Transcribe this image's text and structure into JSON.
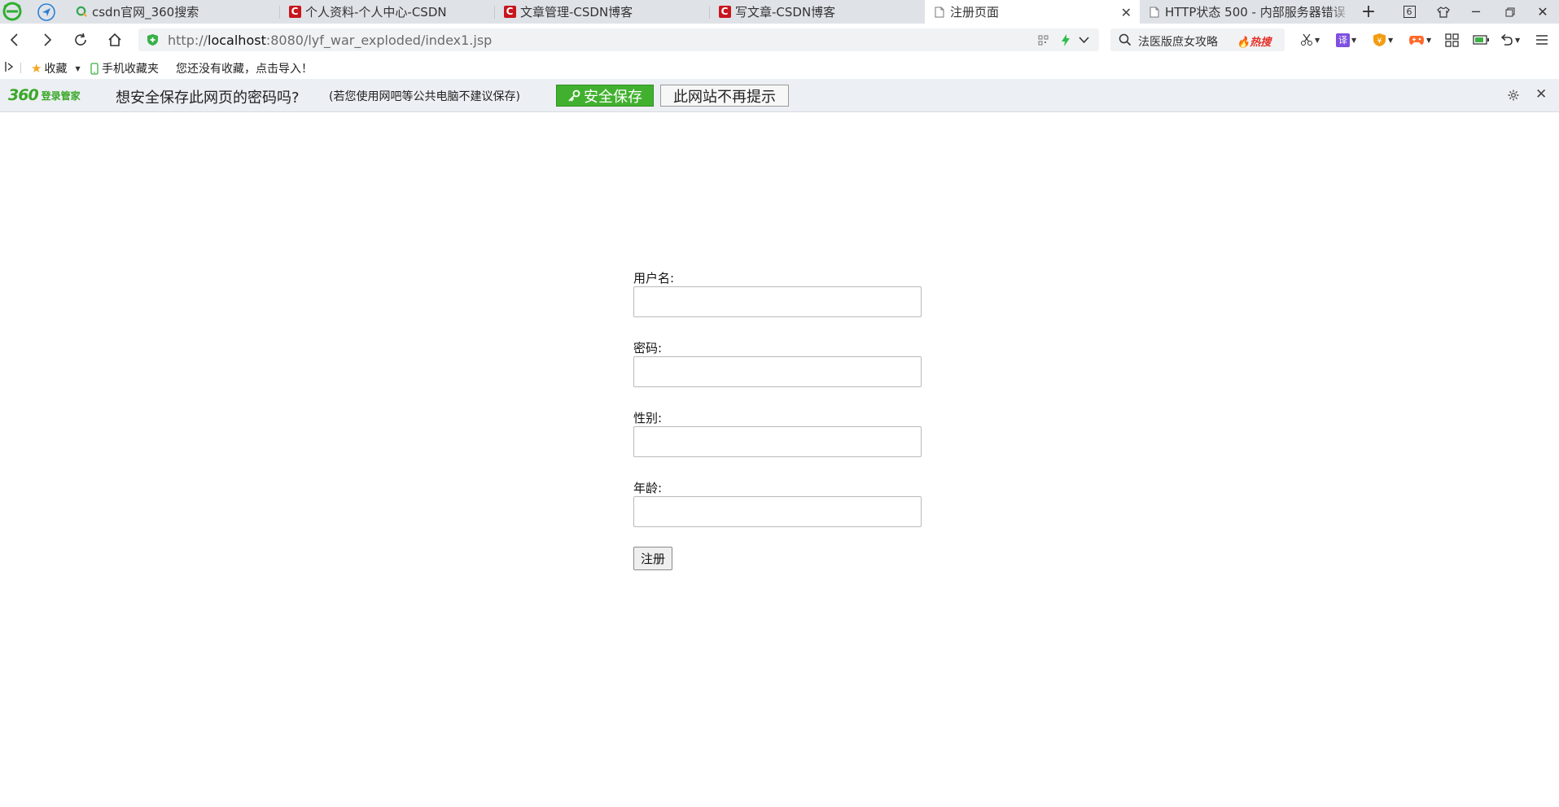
{
  "tabs": [
    {
      "title": "csdn官网_360搜索",
      "icon": "search-360-icon"
    },
    {
      "title": "个人资料-个人中心-CSDN",
      "icon": "csdn-icon"
    },
    {
      "title": "文章管理-CSDN博客",
      "icon": "csdn-icon"
    },
    {
      "title": "写文章-CSDN博客",
      "icon": "csdn-icon"
    },
    {
      "title": "注册页面",
      "icon": "page-icon",
      "active": true
    },
    {
      "title": "HTTP状态 500 - 内部服务器错误",
      "icon": "page-icon"
    }
  ],
  "tab_count": "6",
  "address": {
    "scheme": "http://",
    "host": "localhost",
    "rest": ":8080/lyf_war_exploded/index1.jsp"
  },
  "search": {
    "text": "法医版庶女攻略",
    "hot_label": "热搜"
  },
  "toolbar": {
    "translate_label": "译"
  },
  "bookmarks": {
    "favorites_label": "收藏",
    "mobile_label": "手机收藏夹",
    "empty_hint": "您还没有收藏，点击导入！"
  },
  "infobar": {
    "brand_number": "360",
    "brand_text": "登录管家",
    "question": "想安全保存此网页的密码吗?",
    "note": "(若您使用网吧等公共电脑不建议保存)",
    "save_label": "安全保存",
    "never_label": "此网站不再提示"
  },
  "form": {
    "username_label": "用户名:",
    "password_label": "密码:",
    "gender_label": "性别:",
    "age_label": "年龄:",
    "submit_label": "注册"
  },
  "colors": {
    "tabbar_bg": "#dfe3e8",
    "infobar_bg": "#eceff3",
    "save_green": "#42b02f",
    "csdn_red": "#c8161d",
    "brand_green": "#3aa728"
  }
}
